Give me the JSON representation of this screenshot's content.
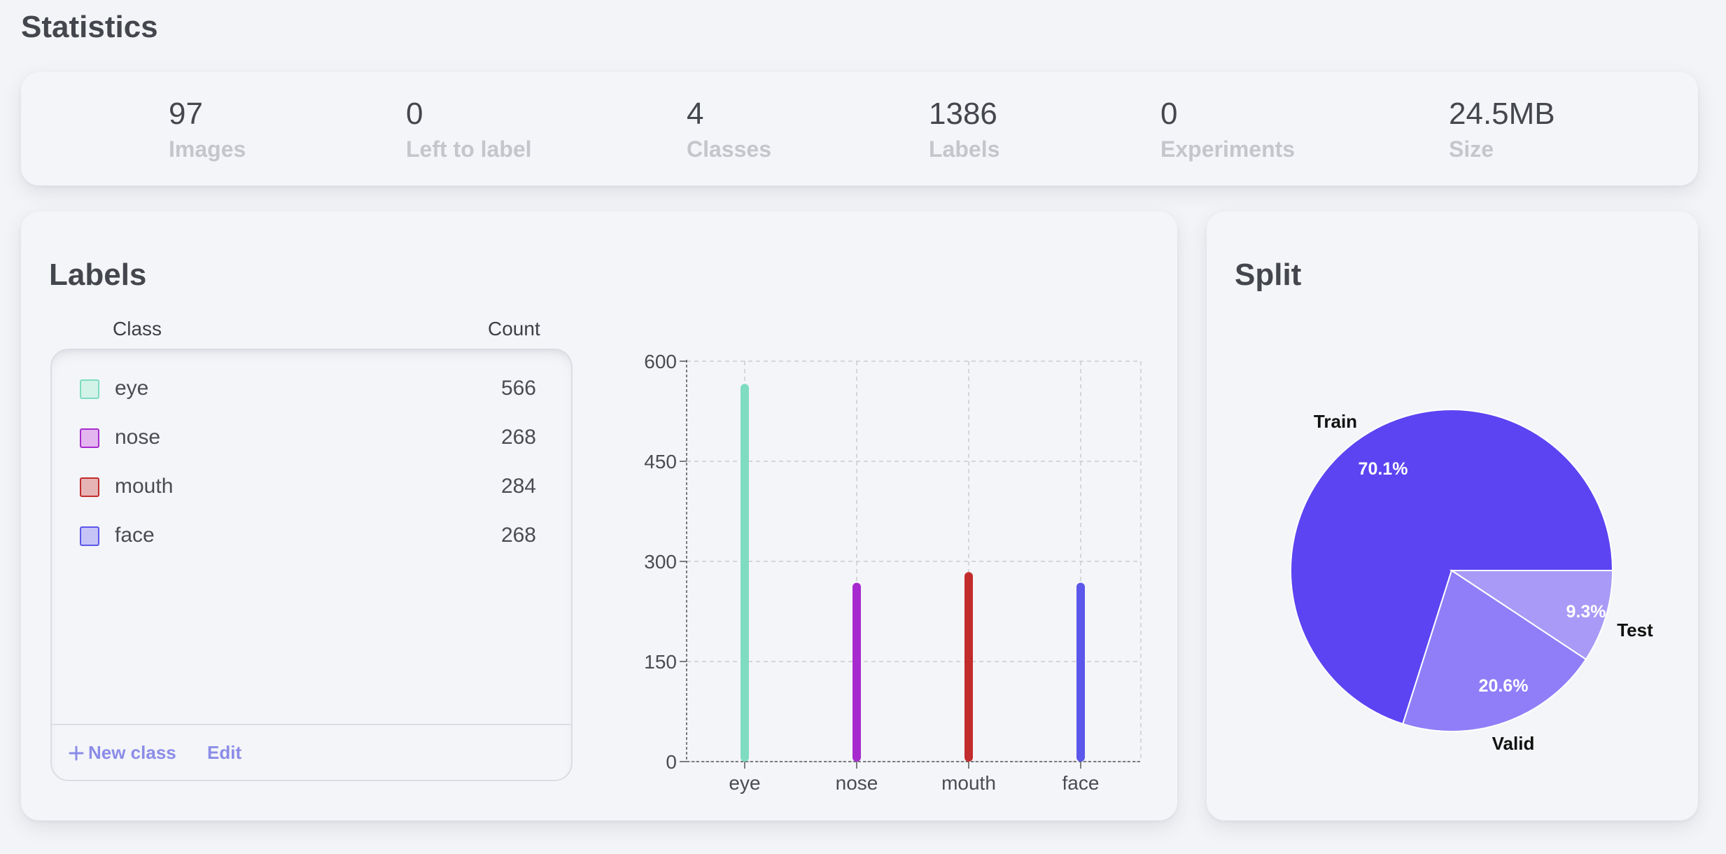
{
  "page": {
    "title": "Statistics"
  },
  "stats": [
    {
      "value": "97",
      "label": "Images"
    },
    {
      "value": "0",
      "label": "Left to label"
    },
    {
      "value": "4",
      "label": "Classes"
    },
    {
      "value": "1386",
      "label": "Labels"
    },
    {
      "value": "0",
      "label": "Experiments"
    },
    {
      "value": "24.5MB",
      "label": "Size"
    }
  ],
  "labels_panel": {
    "title": "Labels",
    "col_class": "Class",
    "col_count": "Count",
    "classes": [
      {
        "name": "eye",
        "count": "566",
        "color": "#7fdcc0",
        "fill": "#d3f2e8"
      },
      {
        "name": "nose",
        "count": "268",
        "color": "#a72ad0",
        "fill": "#e3b6ef"
      },
      {
        "name": "mouth",
        "count": "284",
        "color": "#c22c2c",
        "fill": "#e6b4b4"
      },
      {
        "name": "face",
        "count": "268",
        "color": "#5b57ea",
        "fill": "#c6c4f6"
      }
    ],
    "new_class_label": "New class",
    "new_class_icon": "plus-icon",
    "edit_label": "Edit"
  },
  "split_panel": {
    "title": "Split"
  },
  "chart_data": [
    {
      "type": "bar",
      "categories": [
        "eye",
        "nose",
        "mouth",
        "face"
      ],
      "values": [
        566,
        268,
        284,
        268
      ],
      "colors": [
        "#7fdcc0",
        "#a72ad0",
        "#c22c2c",
        "#5b57ea"
      ],
      "ylim": [
        0,
        600
      ],
      "yticks": [
        0,
        150,
        300,
        450,
        600
      ],
      "grid": true
    },
    {
      "type": "pie",
      "slices": [
        {
          "name": "Train",
          "value": 70.1,
          "label": "70.1%",
          "color": "#5c44f2"
        },
        {
          "name": "Test",
          "value": 9.3,
          "label": "9.3%",
          "color": "#a89af6"
        },
        {
          "name": "Valid",
          "value": 20.6,
          "label": "20.6%",
          "color": "#8f7ef7"
        }
      ]
    }
  ]
}
